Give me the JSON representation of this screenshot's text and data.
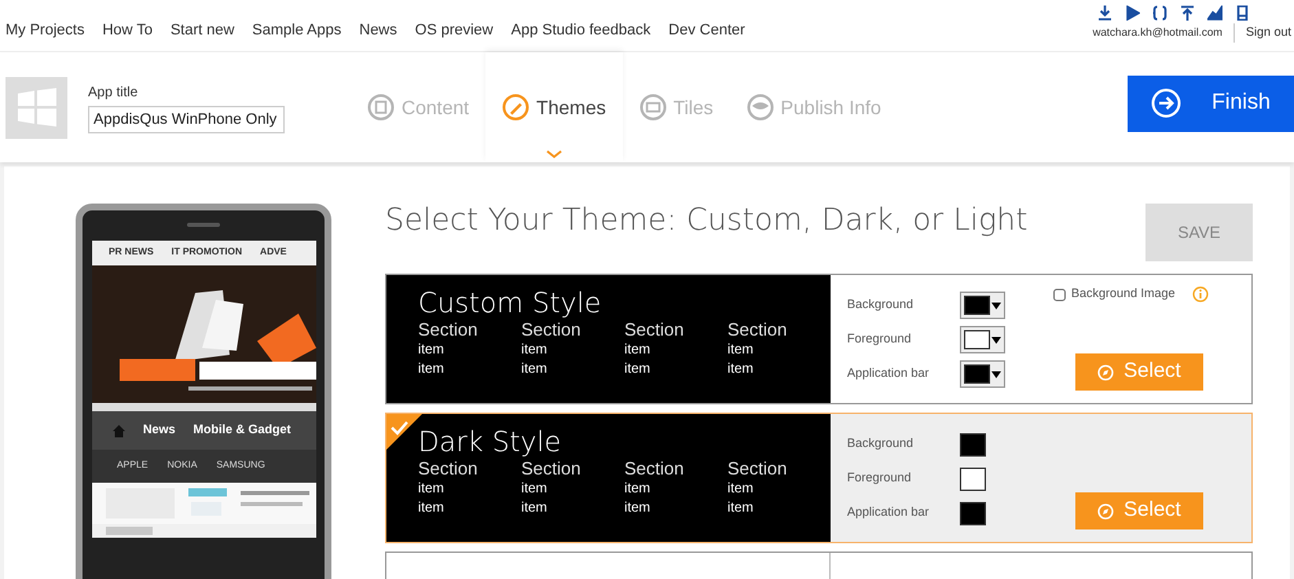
{
  "top_nav": {
    "links": [
      "My Projects",
      "How To",
      "Start new",
      "Sample Apps",
      "News",
      "OS preview",
      "App Studio feedback",
      "Dev Center"
    ],
    "user": "watchara.kh@hotmail.com",
    "sign_out": "Sign out"
  },
  "app_title": {
    "label": "App title",
    "value": "AppdisQus WinPhone Only"
  },
  "steps": [
    {
      "label": "Content",
      "selected": false
    },
    {
      "label": "Themes",
      "selected": true
    },
    {
      "label": "Tiles",
      "selected": false
    },
    {
      "label": "Publish Info",
      "selected": false
    }
  ],
  "finish": "Finish",
  "phone": {
    "tabs": [
      "PR NEWS",
      "IT PROMOTION",
      "ADVE"
    ],
    "menu": [
      "News",
      "Mobile & Gadget"
    ],
    "categories": [
      "APPLE",
      "NOKIA",
      "SAMSUNG"
    ]
  },
  "heading": "Select Your Theme: Custom, Dark, or Light",
  "save": "SAVE",
  "themes": [
    {
      "kind": "custom",
      "title": "Custom Style",
      "selected": false,
      "sections": [
        {
          "heading": "Section",
          "items": [
            "item",
            "item"
          ]
        },
        {
          "heading": "Section",
          "items": [
            "item",
            "item"
          ]
        },
        {
          "heading": "Section",
          "items": [
            "item",
            "item"
          ]
        },
        {
          "heading": "Section",
          "items": [
            "item",
            "item"
          ]
        }
      ],
      "colors": [
        {
          "label": "Background",
          "color": "#000000"
        },
        {
          "label": "Foreground",
          "color": "#ffffff"
        },
        {
          "label": "Application bar",
          "color": "#000000"
        }
      ],
      "background_image": {
        "label": "Background Image",
        "checked": false
      },
      "select": "Select"
    },
    {
      "kind": "fixed",
      "title": "Dark Style",
      "selected": true,
      "sections": [
        {
          "heading": "Section",
          "items": [
            "item",
            "item"
          ]
        },
        {
          "heading": "Section",
          "items": [
            "item",
            "item"
          ]
        },
        {
          "heading": "Section",
          "items": [
            "item",
            "item"
          ]
        },
        {
          "heading": "Section",
          "items": [
            "item",
            "item"
          ]
        }
      ],
      "colors": [
        {
          "label": "Background",
          "color": "#000000"
        },
        {
          "label": "Foreground",
          "color": "#ffffff"
        },
        {
          "label": "Application bar",
          "color": "#000000"
        }
      ],
      "select": "Select"
    },
    {
      "kind": "partial"
    }
  ]
}
